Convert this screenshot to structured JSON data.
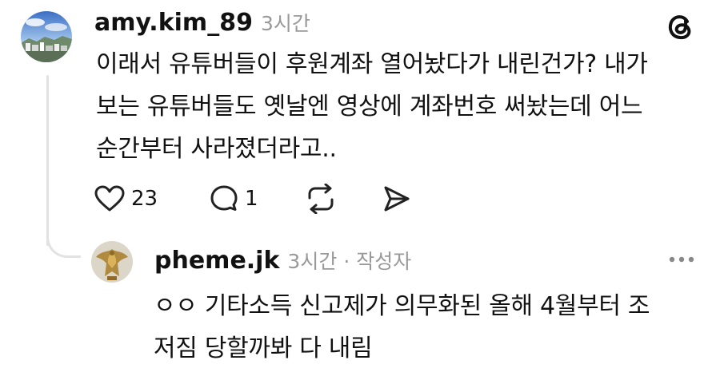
{
  "post": {
    "username": "amy.kim_89",
    "time": "3시간",
    "avatar_icon": "avatar-cityscape",
    "lines": [
      "이래서 유튜버들이 후원계좌 열어놨다가 내린건가? 내가",
      "보는 유튜버들도 옛날엔 영상에 계좌번호 써놨는데 어느",
      "순간부터 사라졌더라고.."
    ],
    "actions": {
      "like_count": "23",
      "comment_count": "1",
      "like_icon": "heart-icon",
      "comment_icon": "comment-icon",
      "repost_icon": "repost-icon",
      "share_icon": "share-icon"
    }
  },
  "reply": {
    "username": "pheme.jk",
    "time": "3시간",
    "separator": "·",
    "author_badge": "작성자",
    "avatar_icon": "avatar-golden-eagle",
    "lines": [
      "ㅇㅇ 기타소득 신고제가 의무화된 올해 4월부터 조",
      "저짐 당할까봐 다 내림"
    ]
  },
  "icons": {
    "brand": "threads-logo-icon",
    "more": "more-options-icon"
  },
  "colors": {
    "text": "#111111",
    "meta": "#999999",
    "thread_line": "#e2e2e2"
  }
}
